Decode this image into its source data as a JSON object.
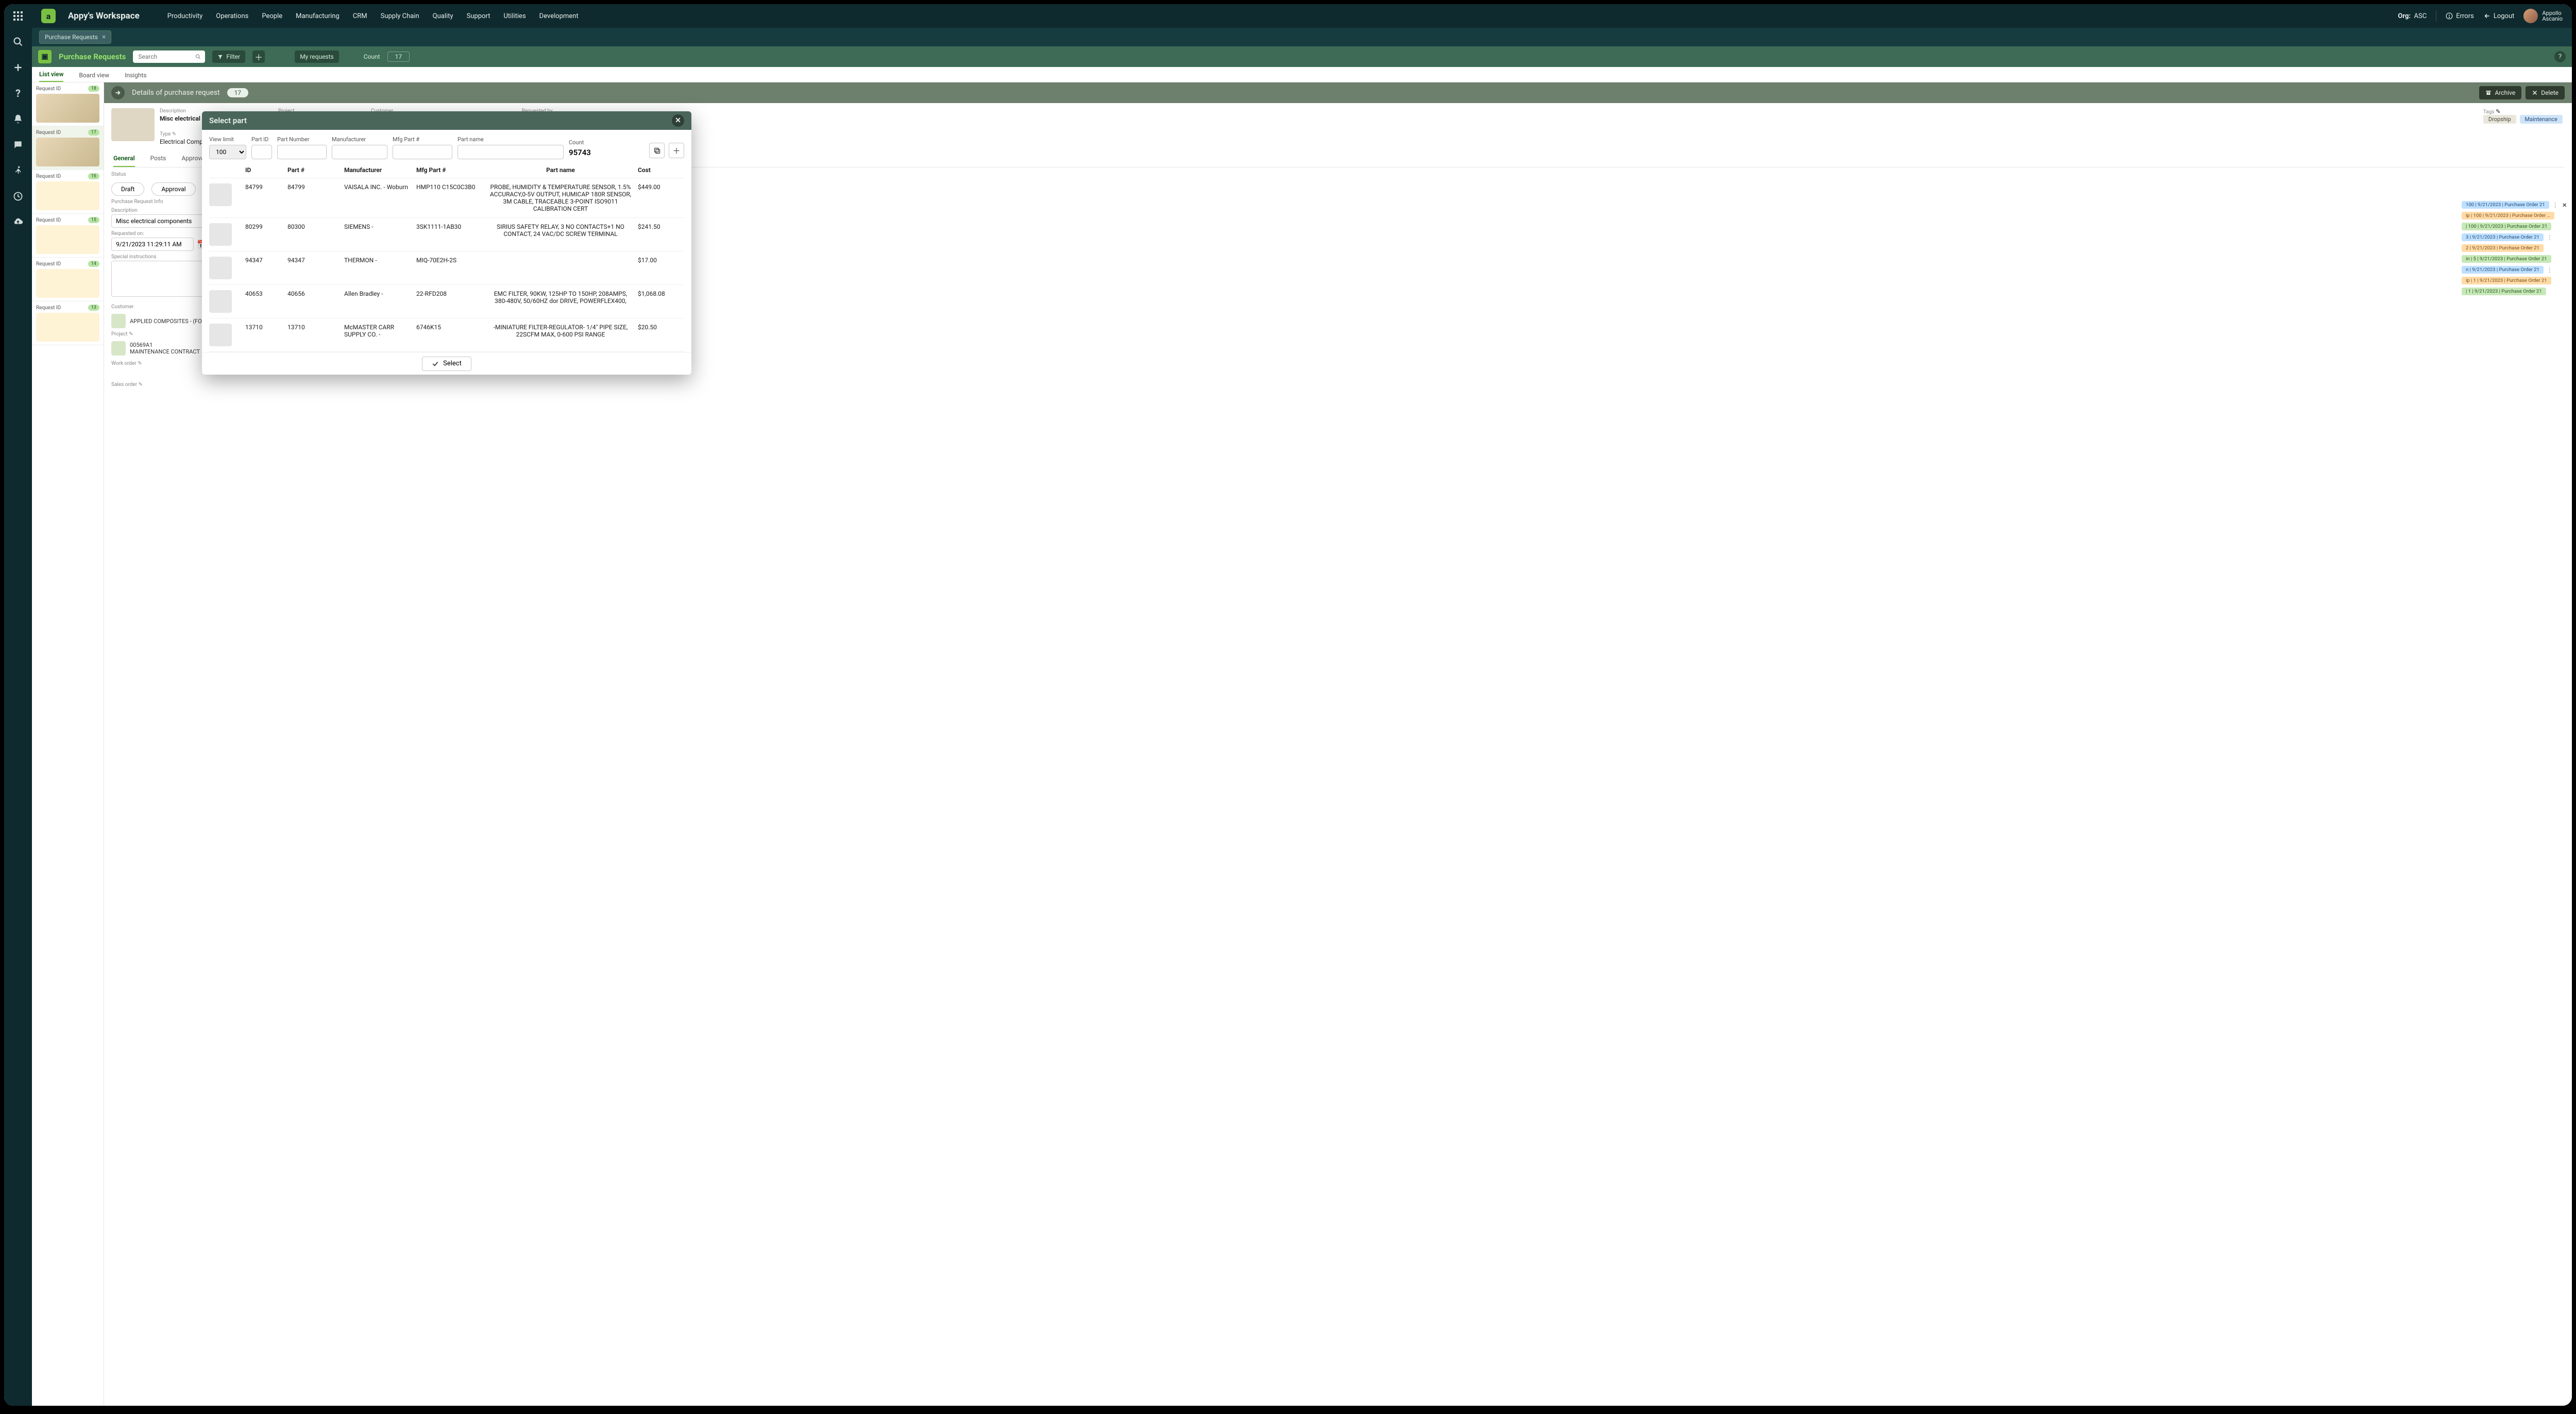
{
  "top": {
    "workspace": "Appy's Workspace",
    "nav": [
      "Productivity",
      "Operations",
      "People",
      "Manufacturing",
      "CRM",
      "Supply Chain",
      "Quality",
      "Support",
      "Utilities",
      "Development"
    ],
    "org_label": "Org:",
    "org_value": "ASC",
    "errors": "Errors",
    "logout": "Logout",
    "user_first": "Appollo",
    "user_last": "Ascanio"
  },
  "open_tab": {
    "label": "Purchase Requests"
  },
  "module": {
    "title": "Purchase Requests",
    "search_placeholder": "Search",
    "filter": "Filter",
    "my_requests": "My requests",
    "count_label": "Count",
    "count_value": "17"
  },
  "view_tabs": [
    "List view",
    "Board view",
    "Insights"
  ],
  "view_active": 0,
  "list_cards": [
    {
      "id_label": "Request ID",
      "id": "18"
    },
    {
      "id_label": "Request ID",
      "id": "17"
    },
    {
      "id_label": "Request ID",
      "id": "16"
    },
    {
      "id_label": "Request ID",
      "id": "15"
    },
    {
      "id_label": "Request ID",
      "id": "14"
    },
    {
      "id_label": "Request ID",
      "id": "13"
    }
  ],
  "detail": {
    "title": "Details of purchase request",
    "count": "17",
    "archive": "Archive",
    "delete": "Delete",
    "labels": {
      "description": "Description",
      "project": "Project",
      "customer": "Customer",
      "requested_by": "Requested by",
      "tags": "Tags",
      "type": "Type",
      "status": "Status",
      "pr_info": "Purchase Request Info",
      "requested_on": "Requested on:",
      "special": "Special instructions",
      "work_order": "Work order",
      "sales_order": "Sales order"
    },
    "description_value": "Misc electrical components",
    "project_code": "00569A1",
    "project_name": "MAINTENANCE CONTRACT",
    "customer_name": "APPLIED COMPOSITES - (FORMERLY ENCORE)",
    "type_value": "Electrical Component",
    "tags": {
      "dropship": "Dropship",
      "maintenance": "Maintenance"
    },
    "detail_tabs": [
      "General",
      "Posts",
      "Approval"
    ],
    "status_draft": "Draft",
    "status_approval": "Approval",
    "requested_on_value": "9/21/2023 11:29:11 AM"
  },
  "notifications": [
    {
      "cls": "nc-blue",
      "text": "100 | 9/21/2023 | Purchase Order 21"
    },
    {
      "cls": "nc-orange",
      "text": "ip | 100 | 9/21/2023 | Purchase Order 21"
    },
    {
      "cls": "nc-green",
      "text": "| 100 | 9/21/2023 | Purchase Order 21"
    },
    {
      "cls": "nc-blue",
      "text": "3 | 9/21/2023 | Purchase Order 21"
    },
    {
      "cls": "nc-orange",
      "text": "2 | 9/21/2023 | Purchase Order 21"
    },
    {
      "cls": "nc-green",
      "text": "in | 5 | 9/21/2023 | Purchase Order 21"
    },
    {
      "cls": "nc-blue",
      "text": "n | 9/21/2023 | Purchase Order 21"
    },
    {
      "cls": "nc-orange",
      "text": "ip | 1 | 9/21/2023 | Purchase Order 21"
    },
    {
      "cls": "nc-green",
      "text": "| 1 | 9/21/2023 | Purchase Order 21"
    }
  ],
  "modal": {
    "title": "Select part",
    "filters": {
      "view_limit_label": "View limit",
      "view_limit_value": "100",
      "part_id_label": "Part ID",
      "part_number_label": "Part Number",
      "manufacturer_label": "Manufacturer",
      "mfg_part_label": "Mfg Part #",
      "part_name_label": "Part name",
      "count_label": "Count",
      "count_value": "95743"
    },
    "columns": {
      "id": "ID",
      "part": "Part #",
      "mfr": "Manufacturer",
      "mfg": "Mfg Part #",
      "name": "Part name",
      "cost": "Cost"
    },
    "rows": [
      {
        "id": "84799",
        "part": "84799",
        "mfr": "VAISALA INC. - Woburn",
        "mfg": "HMP110 C15C0C3B0",
        "name": "PROBE, HUMIDITY & TEMPERATURE SENSOR, 1.5% ACCURACY,0-5V OUTPUT, HUMICAP 180R SENSOR, 3M CABLE, TRACEABLE 3-POINT ISO9011 CALIBRATION CERT",
        "cost": "$449.00"
      },
      {
        "id": "80299",
        "part": "80300",
        "mfr": "SIEMENS -",
        "mfg": "3SK1111-1AB30",
        "name": "SIRIUS SAFETY RELAY, 3 NO CONTACTS+1 NO CONTACT, 24 VAC/DC SCREW TERMINAL",
        "cost": "$241.50"
      },
      {
        "id": "94347",
        "part": "94347",
        "mfr": "THERMON -",
        "mfg": "MIQ-70E2H-2S",
        "name": "",
        "cost": "$17.00"
      },
      {
        "id": "40653",
        "part": "40656",
        "mfr": "Allen Bradley -",
        "mfg": "22-RFD208",
        "name": "EMC FILTER, 90KW, 125HP TO 150HP, 208AMPS, 380-480V, 50/60HZ dor DRIVE, POWERFLEX400,",
        "cost": "$1,068.08"
      },
      {
        "id": "13710",
        "part": "13710",
        "mfr": "McMASTER CARR SUPPLY CO. -",
        "mfg": "6746K15",
        "name": "-MINIATURE FILTER-REGULATOR- 1/4\" PIPE SIZE, 22SCFM MAX, 0-600 PSI RANGE",
        "cost": "$20.50"
      }
    ],
    "select": "Select"
  }
}
